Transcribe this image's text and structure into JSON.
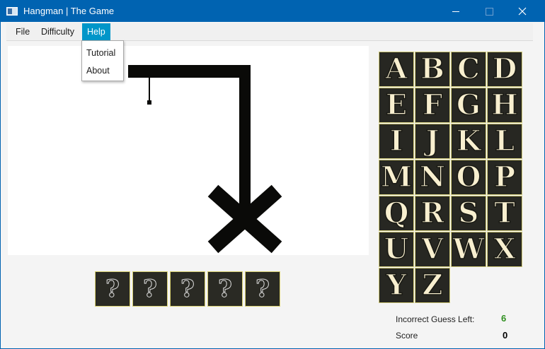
{
  "window": {
    "title": "Hangman | The Game",
    "icon": "app-window-icon",
    "titlebar_color": "#0063b1"
  },
  "menubar": {
    "items": [
      "File",
      "Difficulty",
      "Help"
    ],
    "active_item": "Help",
    "active_color": "#0096c9"
  },
  "help_menu": {
    "items": [
      "Tutorial",
      "About"
    ]
  },
  "hangman": {
    "parts": [
      "gallows-base",
      "gallows-pole",
      "gallows-beam",
      "rope"
    ]
  },
  "word": {
    "slots": [
      "?",
      "?",
      "?",
      "?",
      "?"
    ]
  },
  "letters": [
    "A",
    "B",
    "C",
    "D",
    "E",
    "F",
    "G",
    "H",
    "I",
    "J",
    "K",
    "L",
    "M",
    "N",
    "O",
    "P",
    "Q",
    "R",
    "S",
    "T",
    "U",
    "V",
    "W",
    "X",
    "Y",
    "Z"
  ],
  "stats": {
    "incorrect_label": "Incorrect  Guess Left:",
    "incorrect_value": "6",
    "incorrect_value_color": "#2f8f1f",
    "score_label": "Score",
    "score_value": "0"
  }
}
